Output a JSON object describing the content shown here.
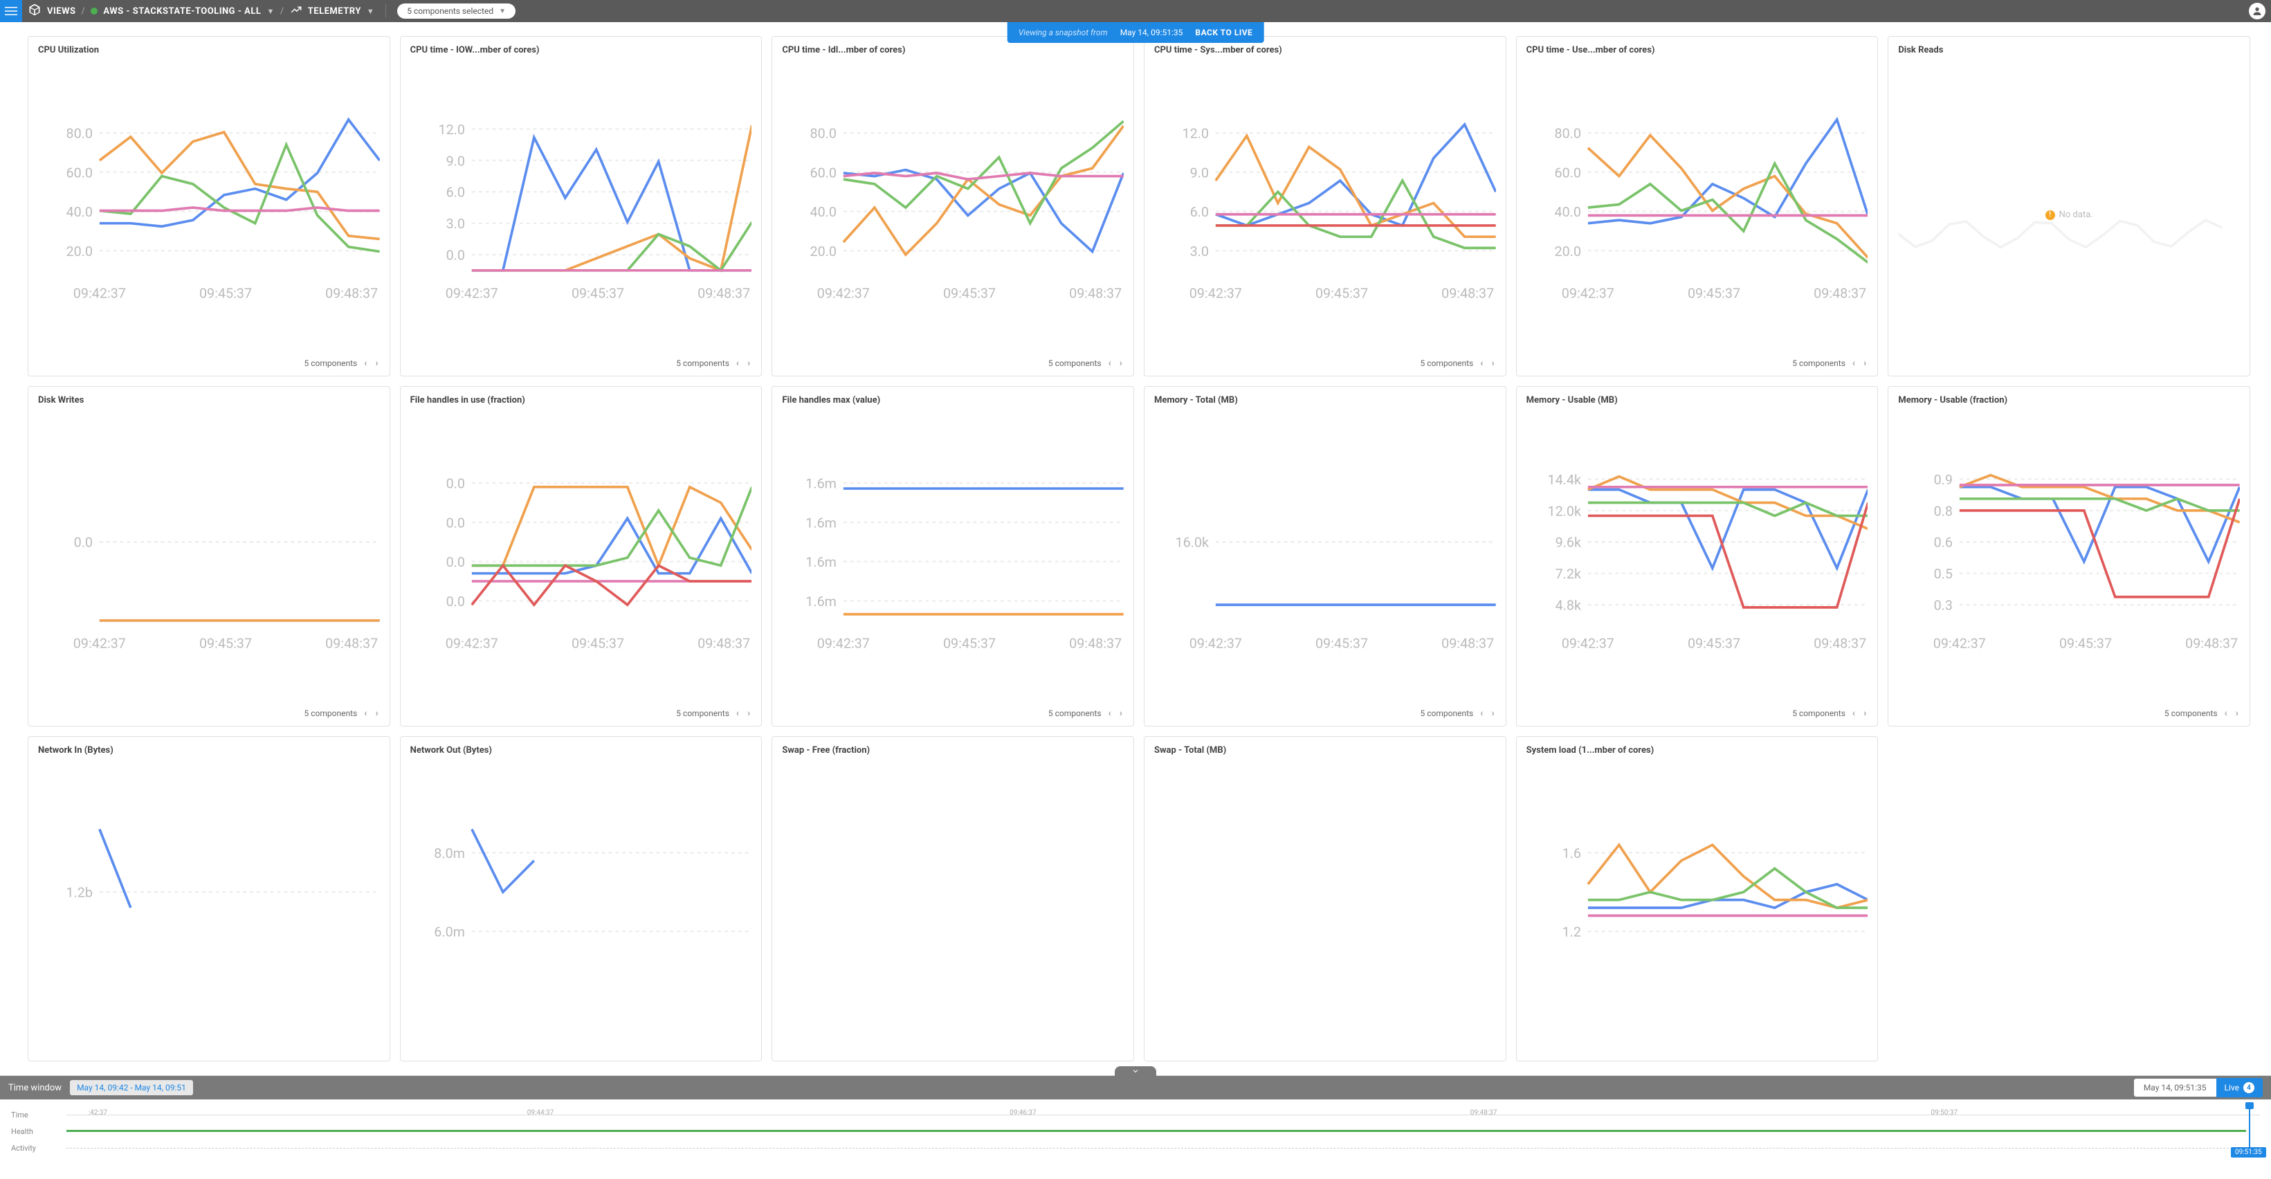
{
  "topbar": {
    "views_label": "VIEWS",
    "view_name": "AWS - STACKSTATE-TOOLING - ALL",
    "telemetry_label": "TELEMETRY",
    "selected_pill": "5 components selected"
  },
  "snapshot": {
    "prefix": "Viewing a snapshot from",
    "time": "May 14, 09:51:35",
    "back": "BACK TO LIVE"
  },
  "components_label": "5 components",
  "no_data_label": "No data.",
  "colors": {
    "blue": "#5b8def",
    "orange": "#f0a14e",
    "green": "#7ac36a",
    "pink": "#e07ab0",
    "red": "#e05a5a"
  },
  "x_ticks": [
    "09:42:37",
    "09:45:37",
    "09:48:37"
  ],
  "timeline": {
    "label": "Time window",
    "range": "May 14, 09:42 - May 14, 09:51",
    "current": "May 14, 09:51:35",
    "live": "Live",
    "live_count": "4",
    "rows": {
      "time": "Time",
      "health": "Health",
      "activity": "Activity"
    },
    "ticks": [
      {
        "pos": 1,
        "label": ":42:37"
      },
      {
        "pos": 21,
        "label": "09:44:37"
      },
      {
        "pos": 43,
        "label": "09:46:37"
      },
      {
        "pos": 64,
        "label": "09:48:37"
      },
      {
        "pos": 85,
        "label": "09:50:37"
      }
    ],
    "playhead_time": "09:51:35"
  },
  "chart_data": [
    {
      "title": "CPU Utilization",
      "type": "line",
      "y_ticks": [
        "80.0",
        "60.0",
        "40.0",
        "20.0"
      ],
      "ylim": [
        0,
        100
      ],
      "foot": true,
      "series": [
        {
          "color": "blue",
          "values": [
            30,
            30,
            28,
            32,
            48,
            52,
            45,
            62,
            96,
            70
          ]
        },
        {
          "color": "orange",
          "values": [
            70,
            85,
            62,
            82,
            88,
            55,
            52,
            50,
            22,
            20
          ]
        },
        {
          "color": "green",
          "values": [
            38,
            36,
            60,
            55,
            40,
            30,
            80,
            35,
            15,
            12
          ]
        },
        {
          "color": "pink",
          "values": [
            38,
            38,
            38,
            40,
            38,
            38,
            38,
            40,
            38,
            38
          ]
        }
      ]
    },
    {
      "title": "CPU time - IOW...mber of cores)",
      "type": "line",
      "y_ticks": [
        "12.0",
        "9.0",
        "6.0",
        "3.0",
        "0.0"
      ],
      "ylim": [
        0,
        13
      ],
      "foot": true,
      "series": [
        {
          "color": "blue",
          "values": [
            0,
            0,
            11,
            6,
            10,
            4,
            9,
            0,
            0,
            0
          ]
        },
        {
          "color": "orange",
          "values": [
            0,
            0,
            0,
            0,
            1,
            2,
            3,
            1,
            0,
            12
          ]
        },
        {
          "color": "green",
          "values": [
            0,
            0,
            0,
            0,
            0,
            0,
            3,
            2,
            0,
            4
          ]
        },
        {
          "color": "pink",
          "values": [
            0,
            0,
            0,
            0,
            0,
            0,
            0,
            0,
            0,
            0
          ]
        }
      ]
    },
    {
      "title": "CPU time - Idl...mber of cores)",
      "type": "line",
      "y_ticks": [
        "80.0",
        "60.0",
        "40.0",
        "20.0"
      ],
      "ylim": [
        0,
        100
      ],
      "foot": true,
      "series": [
        {
          "color": "blue",
          "values": [
            62,
            60,
            64,
            58,
            35,
            52,
            62,
            30,
            12,
            62
          ]
        },
        {
          "color": "orange",
          "values": [
            18,
            40,
            10,
            30,
            58,
            42,
            35,
            60,
            65,
            92
          ]
        },
        {
          "color": "green",
          "values": [
            58,
            55,
            40,
            60,
            52,
            72,
            30,
            65,
            78,
            95
          ]
        },
        {
          "color": "pink",
          "values": [
            60,
            62,
            60,
            62,
            58,
            60,
            62,
            60,
            60,
            60
          ]
        }
      ]
    },
    {
      "title": "CPU time - Sys...mber of cores)",
      "type": "line",
      "y_ticks": [
        "12.0",
        "9.0",
        "6.0",
        "3.0"
      ],
      "ylim": [
        0,
        14
      ],
      "foot": true,
      "series": [
        {
          "color": "blue",
          "values": [
            5,
            4,
            5,
            6,
            8,
            5,
            4,
            10,
            13,
            7
          ]
        },
        {
          "color": "orange",
          "values": [
            8,
            12,
            6,
            11,
            9,
            4,
            5,
            6,
            3,
            3
          ]
        },
        {
          "color": "green",
          "values": [
            4,
            4,
            7,
            4,
            3,
            3,
            8,
            3,
            2,
            2
          ]
        },
        {
          "color": "pink",
          "values": [
            5,
            5,
            5,
            5,
            5,
            5,
            5,
            5,
            5,
            5
          ]
        },
        {
          "color": "red",
          "values": [
            4,
            4,
            4,
            4,
            4,
            4,
            4,
            4,
            4,
            4
          ]
        }
      ]
    },
    {
      "title": "CPU time - Use...mber of cores)",
      "type": "line",
      "y_ticks": [
        "80.0",
        "60.0",
        "40.0",
        "20.0"
      ],
      "ylim": [
        0,
        100
      ],
      "foot": true,
      "series": [
        {
          "color": "blue",
          "values": [
            30,
            32,
            30,
            34,
            55,
            46,
            34,
            68,
            96,
            35
          ]
        },
        {
          "color": "orange",
          "values": [
            78,
            60,
            86,
            65,
            38,
            52,
            60,
            36,
            30,
            8
          ]
        },
        {
          "color": "green",
          "values": [
            40,
            42,
            55,
            38,
            45,
            25,
            68,
            32,
            20,
            5
          ]
        },
        {
          "color": "pink",
          "values": [
            35,
            35,
            35,
            35,
            35,
            35,
            35,
            35,
            35,
            35
          ]
        }
      ]
    },
    {
      "title": "Disk Reads",
      "type": "nodata",
      "foot": false
    },
    {
      "title": "Disk Writes",
      "type": "line",
      "y_ticks": [
        "0.0"
      ],
      "ylim": [
        0,
        1
      ],
      "foot": true,
      "series": [
        {
          "color": "blue",
          "values": [
            0,
            0,
            0,
            0,
            0,
            0,
            0,
            0,
            0,
            0
          ]
        },
        {
          "color": "orange",
          "values": [
            0,
            0,
            0,
            0,
            0,
            0,
            0,
            0,
            0,
            0
          ]
        }
      ]
    },
    {
      "title": "File handles in use (fraction)",
      "type": "line",
      "y_ticks": [
        "0.0",
        "0.0",
        "0.0",
        "0.0"
      ],
      "ylim": [
        -0.5,
        1.5
      ],
      "foot": true,
      "series": [
        {
          "color": "blue",
          "values": [
            0.1,
            0.1,
            0.1,
            0.1,
            0.2,
            0.8,
            0.1,
            0.1,
            0.8,
            0.1
          ]
        },
        {
          "color": "orange",
          "values": [
            0.2,
            0.2,
            1.2,
            1.2,
            1.2,
            1.2,
            0.2,
            1.2,
            1.0,
            0.4
          ]
        },
        {
          "color": "green",
          "values": [
            0.2,
            0.2,
            0.2,
            0.2,
            0.2,
            0.3,
            0.9,
            0.3,
            0.2,
            1.2
          ]
        },
        {
          "color": "pink",
          "values": [
            0.0,
            0.0,
            0.0,
            0.0,
            0.0,
            0.0,
            0.0,
            0.0,
            0.0,
            0.0
          ]
        },
        {
          "color": "red",
          "values": [
            -0.3,
            0.2,
            -0.3,
            0.2,
            0.0,
            -0.3,
            0.2,
            0.0,
            0.0,
            0.0
          ]
        }
      ]
    },
    {
      "title": "File handles max (value)",
      "type": "line",
      "y_ticks": [
        "1.6m",
        "1.6m",
        "1.6m",
        "1.6m"
      ],
      "ylim": [
        0,
        5
      ],
      "foot": true,
      "series": [
        {
          "color": "blue",
          "values": [
            4.2,
            4.2,
            4.2,
            4.2,
            4.2,
            4.2,
            4.2,
            4.2,
            4.2,
            4.2
          ]
        },
        {
          "color": "orange",
          "values": [
            0.2,
            0.2,
            0.2,
            0.2,
            0.2,
            0.2,
            0.2,
            0.2,
            0.2,
            0.2
          ]
        }
      ]
    },
    {
      "title": "Memory - Total (MB)",
      "type": "line",
      "y_ticks": [
        "16.0k"
      ],
      "ylim": [
        0,
        1
      ],
      "foot": true,
      "series": [
        {
          "color": "blue",
          "values": [
            0.1,
            0.1,
            0.1,
            0.1,
            0.1,
            0.1,
            0.1,
            0.1,
            0.1,
            0.1
          ]
        }
      ]
    },
    {
      "title": "Memory - Usable (MB)",
      "type": "line",
      "y_ticks": [
        "14.4k",
        "12.0k",
        "9.6k",
        "7.2k",
        "4.8k"
      ],
      "ylim": [
        4,
        16
      ],
      "foot": true,
      "series": [
        {
          "color": "blue",
          "values": [
            14,
            14,
            13,
            13,
            8,
            14,
            14,
            13,
            8,
            14
          ]
        },
        {
          "color": "orange",
          "values": [
            14,
            15,
            14,
            14,
            14,
            13,
            13,
            12,
            12,
            11
          ]
        },
        {
          "color": "green",
          "values": [
            13,
            13,
            13,
            13,
            13,
            13,
            12,
            13,
            12,
            12
          ]
        },
        {
          "color": "pink",
          "values": [
            14.2,
            14.2,
            14.2,
            14.2,
            14.2,
            14.2,
            14.2,
            14.2,
            14.2,
            14.2
          ]
        },
        {
          "color": "red",
          "values": [
            12,
            12,
            12,
            12,
            12,
            5,
            5,
            5,
            5,
            13
          ]
        }
      ]
    },
    {
      "title": "Memory - Usable (fraction)",
      "type": "line",
      "y_ticks": [
        "0.9",
        "0.8",
        "0.6",
        "0.5",
        "0.3"
      ],
      "ylim": [
        0.2,
        1.0
      ],
      "foot": true,
      "series": [
        {
          "color": "blue",
          "values": [
            0.88,
            0.88,
            0.82,
            0.82,
            0.5,
            0.88,
            0.88,
            0.82,
            0.5,
            0.88
          ]
        },
        {
          "color": "orange",
          "values": [
            0.88,
            0.94,
            0.88,
            0.88,
            0.88,
            0.82,
            0.82,
            0.76,
            0.76,
            0.7
          ]
        },
        {
          "color": "green",
          "values": [
            0.82,
            0.82,
            0.82,
            0.82,
            0.82,
            0.82,
            0.76,
            0.82,
            0.76,
            0.76
          ]
        },
        {
          "color": "pink",
          "values": [
            0.89,
            0.89,
            0.89,
            0.89,
            0.89,
            0.89,
            0.89,
            0.89,
            0.89,
            0.89
          ]
        },
        {
          "color": "red",
          "values": [
            0.76,
            0.76,
            0.76,
            0.76,
            0.76,
            0.32,
            0.32,
            0.32,
            0.32,
            0.82
          ]
        }
      ]
    },
    {
      "title": "Network In (Bytes)",
      "type": "line",
      "y_ticks": [
        "1.2b"
      ],
      "ylim": [
        0,
        2
      ],
      "foot": false,
      "partial": true,
      "series": [
        {
          "color": "blue",
          "values": [
            1.8,
            0.8
          ]
        }
      ]
    },
    {
      "title": "Network Out (Bytes)",
      "type": "line",
      "y_ticks": [
        "8.0m",
        "6.0m"
      ],
      "ylim": [
        0,
        10
      ],
      "foot": false,
      "partial": true,
      "series": [
        {
          "color": "blue",
          "values": [
            9,
            5,
            7
          ]
        }
      ]
    },
    {
      "title": "Swap - Free (fraction)",
      "type": "empty",
      "foot": false
    },
    {
      "title": "Swap - Total (MB)",
      "type": "empty",
      "foot": false
    },
    {
      "title": "System load (1...mber of cores)",
      "type": "line",
      "y_ticks": [
        "1.6",
        "1.2"
      ],
      "ylim": [
        0,
        2
      ],
      "foot": false,
      "partial": true,
      "series": [
        {
          "color": "blue",
          "values": [
            0.8,
            0.8,
            0.8,
            0.8,
            0.9,
            0.9,
            0.8,
            1.0,
            1.1,
            0.9
          ]
        },
        {
          "color": "orange",
          "values": [
            1.1,
            1.6,
            1.0,
            1.4,
            1.6,
            1.2,
            0.9,
            0.9,
            0.8,
            0.9
          ]
        },
        {
          "color": "green",
          "values": [
            0.9,
            0.9,
            1.0,
            0.9,
            0.9,
            1.0,
            1.3,
            1.0,
            0.8,
            0.8
          ]
        },
        {
          "color": "pink",
          "values": [
            0.7,
            0.7,
            0.7,
            0.7,
            0.7,
            0.7,
            0.7,
            0.7,
            0.7,
            0.7
          ]
        }
      ]
    }
  ]
}
